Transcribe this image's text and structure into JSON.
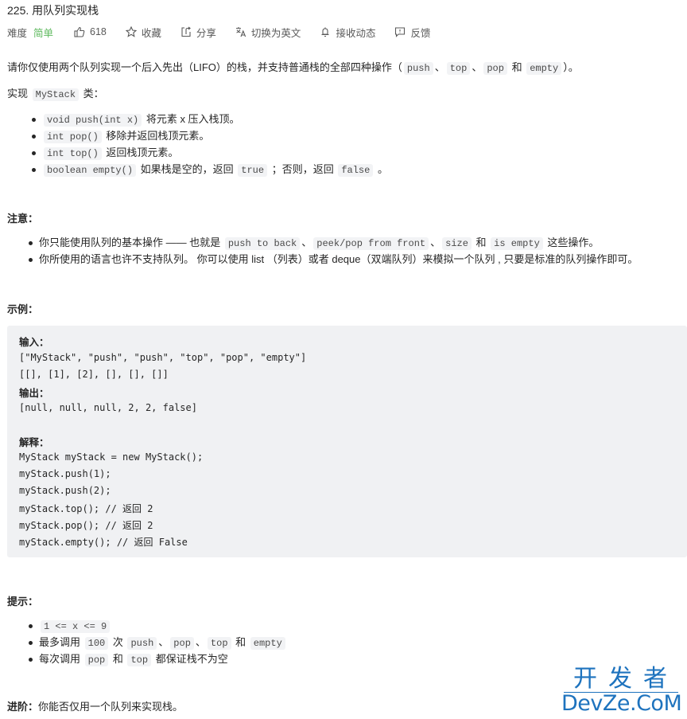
{
  "header": {
    "title": "225. 用队列实现栈",
    "difficulty_label": "难度",
    "difficulty_value": "简单",
    "difficulty_color": "#5cb85c",
    "actions": [
      {
        "icon": "thumbs-up-icon",
        "label": "618"
      },
      {
        "icon": "star-icon",
        "label": "收藏"
      },
      {
        "icon": "share-icon",
        "label": "分享"
      },
      {
        "icon": "translate-icon",
        "label": "切换为英文"
      },
      {
        "icon": "bell-icon",
        "label": "接收动态"
      },
      {
        "icon": "feedback-icon",
        "label": "反馈"
      }
    ]
  },
  "description": {
    "intro": {
      "t1": "请你仅使用两个队列实现一个后入先出（LIFO）的栈，并支持普通栈的全部四种操作（",
      "c1": "push",
      "t2": "、",
      "c2": "top",
      "t3": "、",
      "c3": "pop",
      "t4": " 和 ",
      "c4": "empty",
      "t5": "）。"
    },
    "impl": {
      "t1": "实现 ",
      "c1": "MyStack",
      "t2": " 类："
    },
    "methods": [
      {
        "code": "void push(int x)",
        "text": " 将元素 x 压入栈顶。"
      },
      {
        "code": "int pop()",
        "text": " 移除并返回栈顶元素。"
      },
      {
        "code": "int top()",
        "text": " 返回栈顶元素。"
      },
      {
        "code": "boolean empty()",
        "text": " 如果栈是空的，返回 ",
        "code2": "true",
        "text2": " ；否则，返回 ",
        "code3": "false",
        "text3": " 。"
      }
    ]
  },
  "notes": {
    "heading": "注意：",
    "items": [
      {
        "t1": "你只能使用队列的基本操作 —— 也就是 ",
        "c1": "push to back",
        "t2": "、",
        "c2": "peek/pop from front",
        "t3": "、",
        "c3": "size",
        "t4": " 和 ",
        "c4": "is empty",
        "t5": " 这些操作。"
      },
      {
        "t1": "你所使用的语言也许不支持队列。 你可以使用 list （列表）或者 deque（双端队列）来模拟一个队列 , 只要是标准的队列操作即可。"
      }
    ]
  },
  "example": {
    "heading": "示例：",
    "input_label": "输入：",
    "input_lines": [
      "[\"MyStack\", \"push\", \"push\", \"top\", \"pop\", \"empty\"]",
      "[[], [1], [2], [], [], []]"
    ],
    "output_label": "输出：",
    "output_lines": [
      "[null, null, null, 2, 2, false]"
    ],
    "explain_label": "解释：",
    "explain_lines": [
      "MyStack myStack = new MyStack();",
      "myStack.push(1);",
      "myStack.push(2);",
      "myStack.top(); // 返回 2",
      "myStack.pop(); // 返回 2",
      "myStack.empty(); // 返回 False"
    ]
  },
  "hints": {
    "heading": "提示：",
    "items": [
      {
        "c1": "1 <= x <= 9"
      },
      {
        "t1": "最多调用 ",
        "c1": "100",
        "t2": " 次 ",
        "c2": "push",
        "t3": "、",
        "c3": "pop",
        "t4": "、",
        "c4": "top",
        "t5": " 和 ",
        "c5": "empty"
      },
      {
        "t1": "每次调用 ",
        "c1": "pop",
        "t2": " 和 ",
        "c2": "top",
        "t3": " 都保证栈不为空"
      }
    ]
  },
  "followup": {
    "label": "进阶：",
    "text": "你能否仅用一个队列来实现栈。"
  },
  "watermark": {
    "cn": "开发者",
    "en": "DevZe.CoM",
    "color": "#1e73be"
  }
}
